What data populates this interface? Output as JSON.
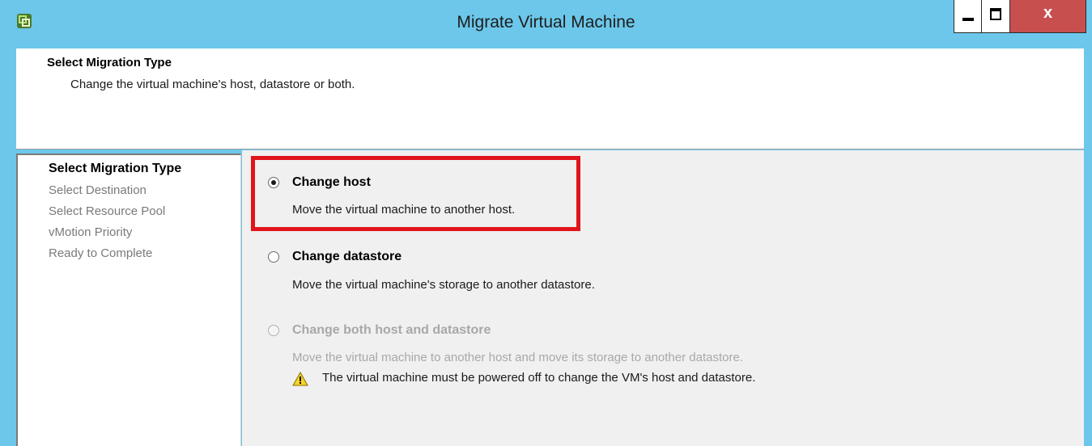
{
  "window": {
    "title": "Migrate Virtual Machine",
    "controls": {
      "minimize": "minimize",
      "maximize": "maximize",
      "close": "x"
    }
  },
  "header": {
    "title": "Select Migration Type",
    "subtitle": "Change the virtual machine's host, datastore or both."
  },
  "steps": [
    {
      "label": "Select Migration Type",
      "active": true
    },
    {
      "label": "Select Destination",
      "active": false
    },
    {
      "label": "Select Resource Pool",
      "active": false
    },
    {
      "label": "vMotion Priority",
      "active": false
    },
    {
      "label": "Ready to Complete",
      "active": false
    }
  ],
  "options": [
    {
      "label": "Change host",
      "description": "Move the virtual machine to another host.",
      "selected": true,
      "enabled": true
    },
    {
      "label": "Change datastore",
      "description": "Move the virtual machine's storage to another datastore.",
      "selected": false,
      "enabled": true
    },
    {
      "label": "Change both host and datastore",
      "description": "Move the virtual machine to another host and move its storage to another datastore.",
      "selected": false,
      "enabled": false
    }
  ],
  "warning": "The virtual machine must be powered off to change the VM's host and datastore.",
  "colors": {
    "titlebar": "#6cc7ea",
    "highlight": "#e0141a",
    "close": "#c7504f"
  }
}
